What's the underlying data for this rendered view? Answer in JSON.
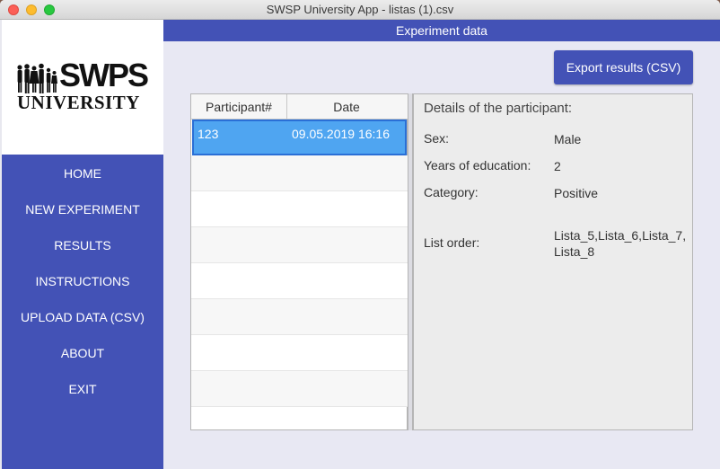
{
  "window": {
    "title": "SWSP University App - listas (1).csv"
  },
  "logo": {
    "line1": "SWPS",
    "line2": "UNIVERSITY"
  },
  "sidebar": {
    "items": [
      {
        "label": "HOME"
      },
      {
        "label": "NEW EXPERIMENT"
      },
      {
        "label": "RESULTS"
      },
      {
        "label": "INSTRUCTIONS"
      },
      {
        "label": "UPLOAD DATA (CSV)"
      },
      {
        "label": "ABOUT"
      },
      {
        "label": "EXIT"
      }
    ]
  },
  "header": {
    "title": "Experiment data"
  },
  "toolbar": {
    "export_label": "Export results (CSV)"
  },
  "table": {
    "columns": [
      "Participant#",
      "Date"
    ],
    "rows": [
      {
        "participant": "123",
        "date": "09.05.2019 16:16",
        "selected": true
      }
    ]
  },
  "details": {
    "title": "Details of the participant:",
    "sex_label": "Sex:",
    "sex_value": "Male",
    "education_label": "Years of education:",
    "education_value": "2",
    "category_label": "Category:",
    "category_value": "Positive",
    "list_order_label": "List order:",
    "list_order_value": "Lista_5,Lista_6,Lista_7,Lista_8"
  },
  "colors": {
    "accent": "#4352b6",
    "selection": "#4fa5f1"
  }
}
